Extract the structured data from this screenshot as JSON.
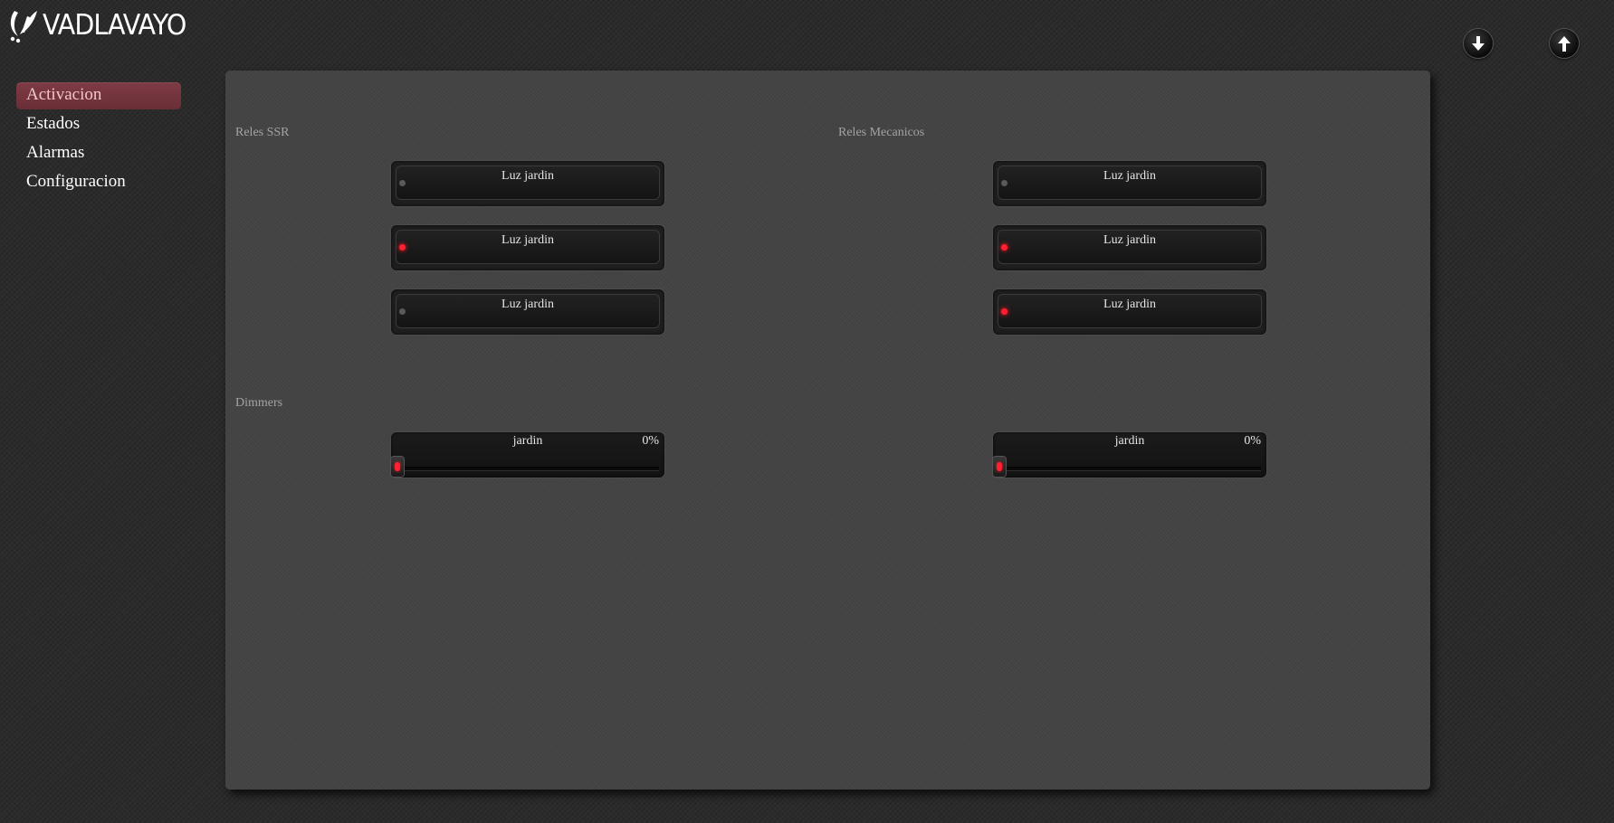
{
  "brand": {
    "name": "VADLAVAYO"
  },
  "toolbar": {
    "download_icon": "arrow-down-icon",
    "upload_icon": "arrow-up-icon"
  },
  "nav": {
    "items": [
      {
        "label": "Activacion",
        "active": true
      },
      {
        "label": "Estados",
        "active": false
      },
      {
        "label": "Alarmas",
        "active": false
      },
      {
        "label": "Configuracion",
        "active": false
      }
    ]
  },
  "sections": {
    "ssr": {
      "title": "Reles SSR",
      "relays": [
        {
          "label": "Luz jardin",
          "on": false
        },
        {
          "label": "Luz jardin",
          "on": true
        },
        {
          "label": "Luz jardin",
          "on": false
        }
      ]
    },
    "mechanical": {
      "title": "Reles Mecanicos",
      "relays": [
        {
          "label": "Luz jardin",
          "on": false
        },
        {
          "label": "Luz jardin",
          "on": true
        },
        {
          "label": "Luz jardin",
          "on": true
        }
      ]
    },
    "dimmers": {
      "title": "Dimmers",
      "items": [
        {
          "name": "jardin",
          "value_label": "0%",
          "level": 0
        },
        {
          "name": "jardin",
          "value_label": "0%",
          "level": 0
        }
      ]
    }
  },
  "colors": {
    "active_nav": "#7e3b45",
    "led_on": "#ff2030",
    "led_off": "#5a5a5a",
    "panel": "#444444",
    "background": "#2b2b2b"
  }
}
